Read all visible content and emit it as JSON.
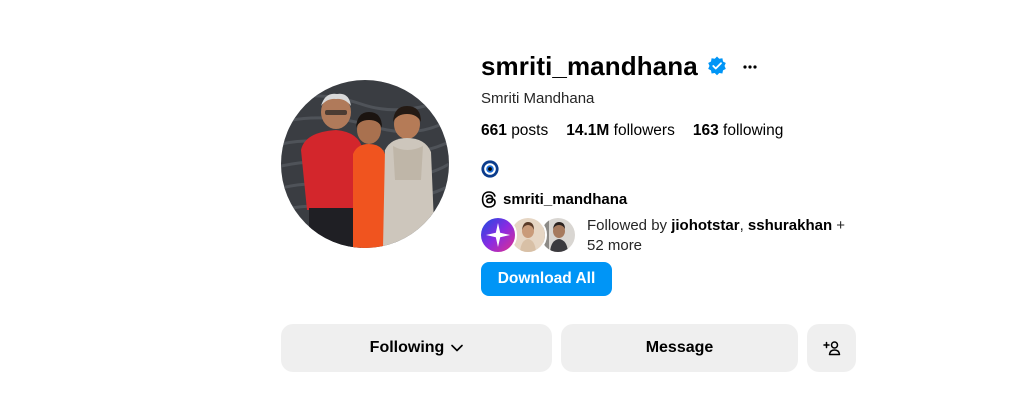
{
  "profile": {
    "username": "smriti_mandhana",
    "full_name": "Smriti Mandhana",
    "verified": true
  },
  "stats": {
    "posts_count": "661",
    "posts_label": "posts",
    "followers_count": "14.1M",
    "followers_label": "followers",
    "following_count": "163",
    "following_label": "following"
  },
  "bio": {
    "emoji_icon": "nazar-amulet-icon",
    "threads_handle": "smriti_mandhana"
  },
  "followed_by": {
    "prefix": "Followed by ",
    "user1": "jiohotstar",
    "separator": ", ",
    "user2": "sshurakhan",
    "suffix": " + 52 more"
  },
  "actions": {
    "download_label": "Download All",
    "following_label": "Following",
    "message_label": "Message"
  },
  "colors": {
    "accent": "#0095f6",
    "button_bg": "#efefef",
    "verified": "#0095f6"
  }
}
